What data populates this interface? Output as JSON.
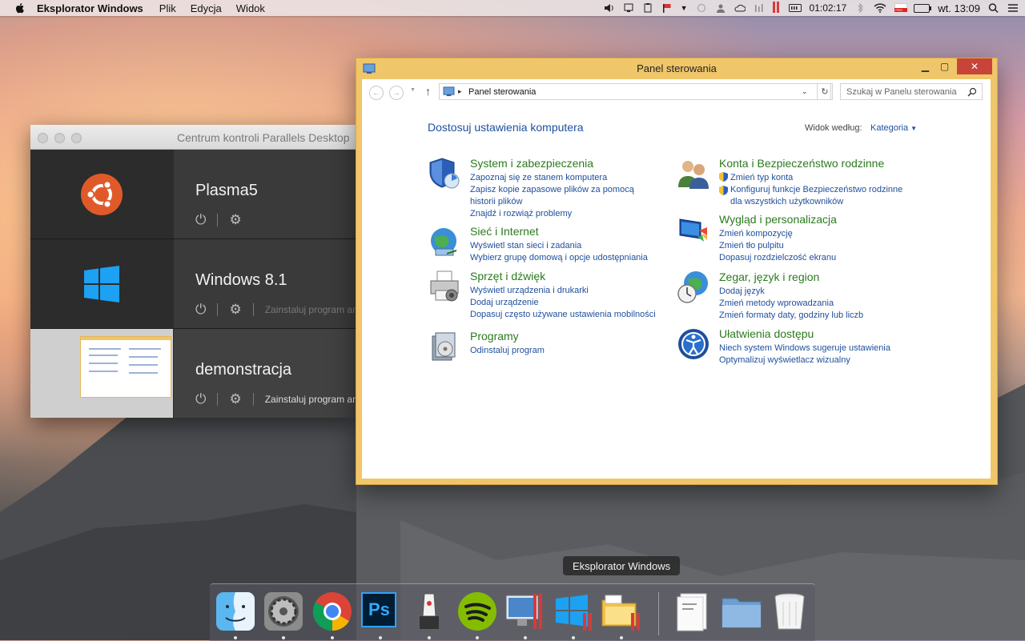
{
  "menubar": {
    "app_name": "Eksplorator Windows",
    "menus": [
      "Plik",
      "Edycja",
      "Widok"
    ],
    "timer": "01:02:17",
    "clock": "wt. 13:09",
    "lang_badge": "PRO"
  },
  "parallels": {
    "title": "Centrum kontroli Parallels Desktop",
    "vms": [
      {
        "name": "Plasma5",
        "action": ""
      },
      {
        "name": "Windows 8.1",
        "action": "Zainstaluj program ani"
      },
      {
        "name": "demonstracja",
        "action": "Zainstaluj program ani"
      }
    ]
  },
  "explorer": {
    "title": "Panel sterowania",
    "breadcrumb": "Panel sterowania",
    "search_placeholder": "Szukaj w Panelu sterowania",
    "heading": "Dostosuj ustawienia komputera",
    "view_by_label": "Widok według:",
    "view_by_value": "Kategoria",
    "categories": [
      {
        "title": "System i zabezpieczenia",
        "links": [
          "Zapoznaj się ze stanem komputera",
          "Zapisz kopie zapasowe plików za pomocą historii plików",
          "Znajdź i rozwiąż problemy"
        ]
      },
      {
        "title": "Sieć i Internet",
        "links": [
          "Wyświetl stan sieci i zadania",
          "Wybierz grupę domową i opcje udostępniania"
        ]
      },
      {
        "title": "Sprzęt i dźwięk",
        "links": [
          "Wyświetl urządzenia i drukarki",
          "Dodaj urządzenie",
          "Dopasuj często używane ustawienia mobilności"
        ]
      },
      {
        "title": "Programy",
        "links": [
          "Odinstaluj program"
        ]
      },
      {
        "title": "Konta i Bezpieczeństwo rodzinne",
        "links": [
          "Zmień typ konta",
          "Konfiguruj funkcje Bezpieczeństwo rodzinne dla wszystkich użytkowników"
        ]
      },
      {
        "title": "Wygląd i personalizacja",
        "links": [
          "Zmień kompozycję",
          "Zmień tło pulpitu",
          "Dopasuj rozdzielczość ekranu"
        ]
      },
      {
        "title": "Zegar, język i region",
        "links": [
          "Dodaj język",
          "Zmień metody wprowadzania",
          "Zmień formaty daty, godziny lub liczb"
        ]
      },
      {
        "title": "Ułatwienia dostępu",
        "links": [
          "Niech system Windows sugeruje ustawienia",
          "Optymalizuj wyświetlacz wizualny"
        ]
      }
    ]
  },
  "dock": {
    "tooltip": "Eksplorator Windows",
    "ps_label": "Ps",
    "items": [
      "finder-icon",
      "system-preferences-icon",
      "chrome-icon",
      "photoshop-icon",
      "robot-icon",
      "spotify-icon",
      "parallels-desktop-icon",
      "windows-icon",
      "windows-explorer-icon",
      "document-icon",
      "folder-icon",
      "trash-icon"
    ]
  },
  "colors": {
    "link": "#1e4f9c",
    "category_title": "#2b7a1e",
    "win_frame": "#f0c66a",
    "win_close": "#c8443a"
  }
}
